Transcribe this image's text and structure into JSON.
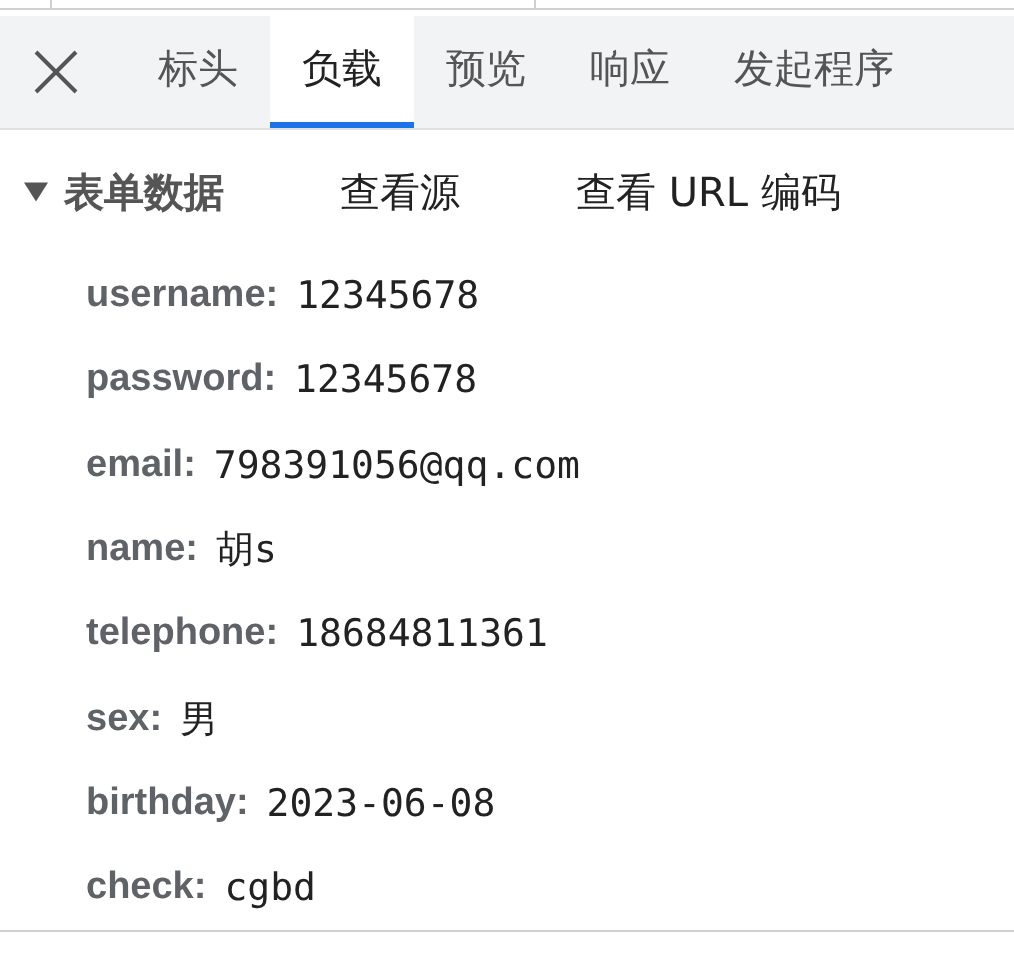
{
  "tabs": [
    {
      "label": "标头",
      "selected": false
    },
    {
      "label": "负载",
      "selected": true
    },
    {
      "label": "预览",
      "selected": false
    },
    {
      "label": "响应",
      "selected": false
    },
    {
      "label": "发起程序",
      "selected": false
    }
  ],
  "section": {
    "title": "表单数据",
    "expanded": true,
    "links": [
      "查看源",
      "查看 URL 编码"
    ],
    "fields": [
      {
        "key": "username:",
        "value": "12345678"
      },
      {
        "key": "password:",
        "value": "12345678"
      },
      {
        "key": "email:",
        "value": "798391056@qq.com"
      },
      {
        "key": "name:",
        "value": "胡s"
      },
      {
        "key": "telephone:",
        "value": "18684811361"
      },
      {
        "key": "sex:",
        "value": "男"
      },
      {
        "key": "birthday:",
        "value": "2023-06-08"
      },
      {
        "key": "check:",
        "value": "cgbd"
      }
    ]
  }
}
